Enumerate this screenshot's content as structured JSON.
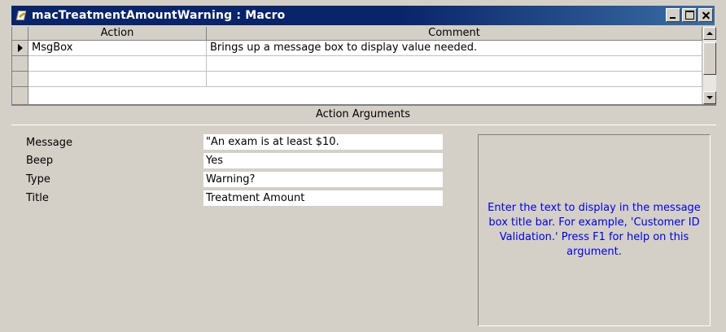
{
  "window": {
    "title": "macTreatmentAmountWarning : Macro"
  },
  "grid": {
    "columns": [
      "Action",
      "Comment"
    ],
    "rows": [
      {
        "action": "MsgBox",
        "comment": "Brings up a message  box to display value needed."
      },
      {
        "action": "",
        "comment": ""
      },
      {
        "action": "",
        "comment": ""
      }
    ]
  },
  "arguments": {
    "section_label": "Action Arguments",
    "items": [
      {
        "label": "Message",
        "value": "\"An exam is at least $10."
      },
      {
        "label": "Beep",
        "value": "Yes"
      },
      {
        "label": "Type",
        "value": "Warning?"
      },
      {
        "label": "Title",
        "value": "Treatment Amount"
      }
    ],
    "help_text": "Enter the text to display in the message box title bar. For example, 'Customer ID Validation.'  Press F1 for help on this argument."
  },
  "colors": {
    "title_bar": "#0a246a",
    "help_text": "#0000e0",
    "face": "#d4d0c8"
  }
}
